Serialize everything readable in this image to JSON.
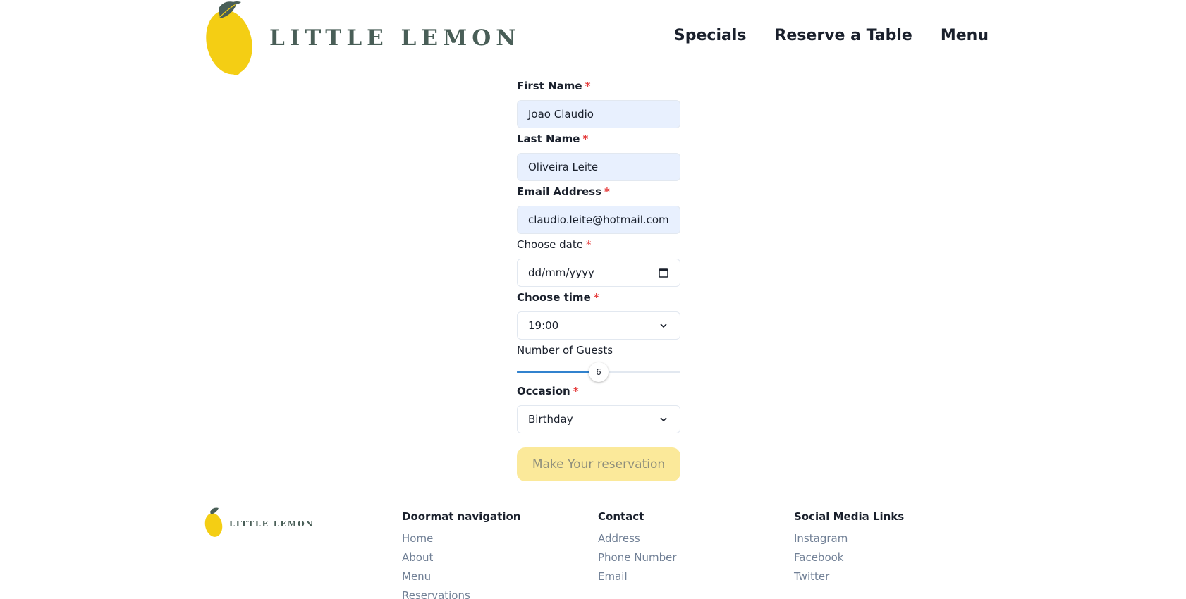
{
  "header": {
    "logo_text": "LITTLE LEMON",
    "nav": [
      "Specials",
      "Reserve a Table",
      "Menu"
    ]
  },
  "form": {
    "first_name": {
      "label": "First Name",
      "required": "*",
      "value": "Joao Claudio"
    },
    "last_name": {
      "label": "Last Name",
      "required": "*",
      "value": "Oliveira Leite"
    },
    "email": {
      "label": "Email Address",
      "required": "*",
      "value": "claudio.leite@hotmail.com"
    },
    "date": {
      "label": "Choose date",
      "required": "*",
      "placeholder": "dd/mm/yyyy"
    },
    "time": {
      "label": "Choose time",
      "required": "*",
      "value": "19:00"
    },
    "guests": {
      "label": "Number of Guests",
      "value": "6",
      "fraction": 0.5
    },
    "occasion": {
      "label": "Occasion",
      "required": "*",
      "value": "Birthday"
    },
    "submit_label": "Make Your reservation"
  },
  "footer": {
    "logo_text": "LITTLE LEMON",
    "doormat": {
      "heading": "Doormat navigation",
      "links": [
        "Home",
        "About",
        "Menu",
        "Reservations"
      ]
    },
    "contact": {
      "heading": "Contact",
      "links": [
        "Address",
        "Phone Number",
        "Email"
      ]
    },
    "social": {
      "heading": "Social Media Links",
      "links": [
        "Instagram",
        "Facebook",
        "Twitter"
      ]
    }
  },
  "colors": {
    "brand_green": "#495e57",
    "brand_yellow": "#f4ce14",
    "autofill_bg": "#e8f0fe",
    "slider_blue": "#3182ce",
    "required_red": "#e53e3e",
    "button_disabled": "#fbe99a"
  },
  "icons": {
    "logo": "lemon-icon",
    "date": "calendar-icon",
    "select": "chevron-down-icon"
  }
}
